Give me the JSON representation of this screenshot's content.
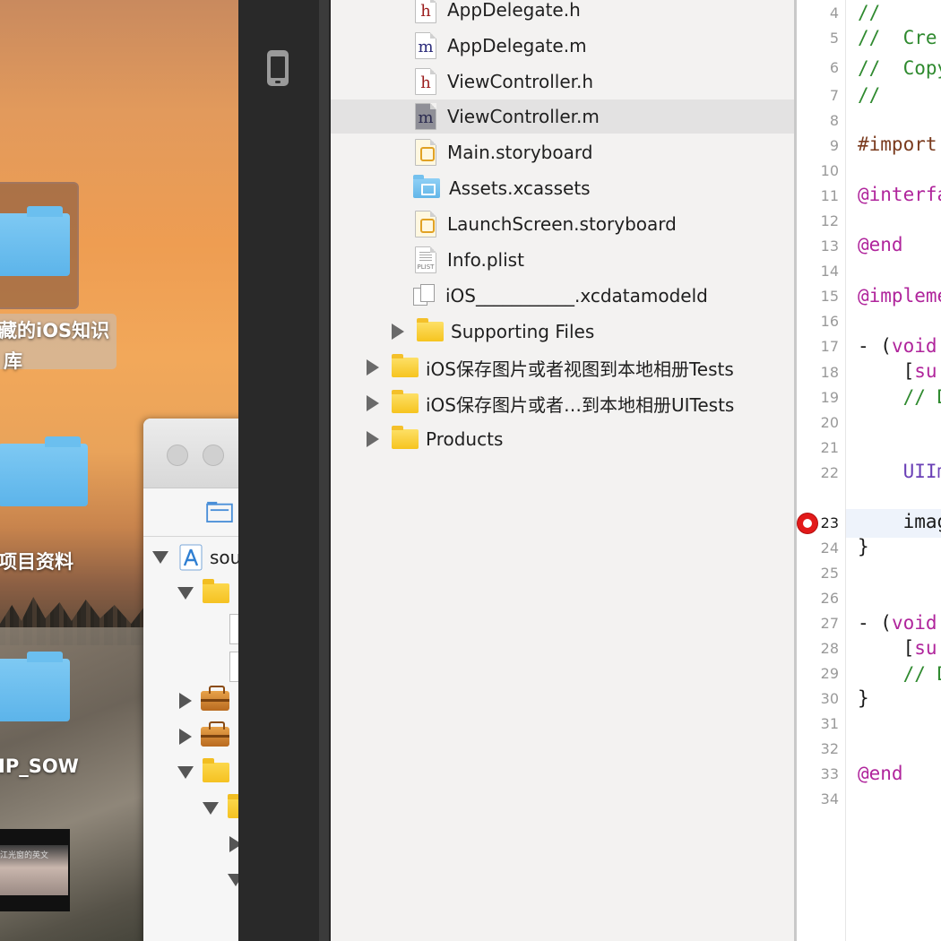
{
  "desktop": {
    "items": [
      {
        "label_line1": "藏的iOS知识",
        "label_line2": "库"
      },
      {
        "label": "项目资料"
      },
      {
        "label": "IP_SOW"
      }
    ],
    "thumbnail_text": "江光窗的英文"
  },
  "finder": {
    "tree": [
      {
        "label": "sou"
      }
    ]
  },
  "navigator": {
    "files": [
      {
        "label": "AppDelegate.h",
        "icon": "h-file-icon"
      },
      {
        "label": "AppDelegate.m",
        "icon": "m-file-icon"
      },
      {
        "label": "ViewController.h",
        "icon": "h-file-icon"
      },
      {
        "label": "ViewController.m",
        "icon": "m-file-icon",
        "selected": true
      },
      {
        "label": "Main.storyboard",
        "icon": "storyboard-icon"
      },
      {
        "label": "Assets.xcassets",
        "icon": "assets-folder-icon"
      },
      {
        "label": "LaunchScreen.storyboard",
        "icon": "storyboard-icon"
      },
      {
        "label": "Info.plist",
        "icon": "plist-icon"
      },
      {
        "label": "iOS___________.xcdatamodeld",
        "icon": "data-model-icon"
      },
      {
        "label": "Supporting Files",
        "icon": "folder-icon"
      },
      {
        "label": "iOS保存图片或者视图到本地相册Tests",
        "icon": "folder-icon"
      },
      {
        "label": "iOS保存图片或者…到本地相册UITests",
        "icon": "folder-icon"
      },
      {
        "label": "Products",
        "icon": "folder-icon"
      }
    ],
    "icon_letters": {
      "h": "h",
      "m": "m",
      "plist": "PLIST"
    }
  },
  "editor": {
    "line_numbers": [
      "4",
      "5",
      "6",
      "7",
      "8",
      "9",
      "10",
      "11",
      "12",
      "13",
      "14",
      "15",
      "16",
      "17",
      "18",
      "19",
      "20",
      "21",
      "22",
      "23",
      "24",
      "25",
      "26",
      "27",
      "28",
      "29",
      "30",
      "31",
      "32",
      "33",
      "34"
    ],
    "breakpoint_line": "23",
    "lines": {
      "l4": "//",
      "l5": "//  Cre",
      "l6": "//  Copy",
      "l7": "//",
      "l9": "#import",
      "l11": "@interfa",
      "l13": "@end",
      "l15": "@impleme",
      "l17a": "- (",
      "l17b": "void",
      "l18a": "    [",
      "l18b": "su",
      "l19": "    // D",
      "l22": "    UIIm",
      "l23": "    imag",
      "l24": "}",
      "l27a": "- (",
      "l27b": "void",
      "l28a": "    [",
      "l28b": "su",
      "l29": "    // D",
      "l30": "}",
      "l33": "@end"
    }
  },
  "colors": {
    "navigator_bg": "#f3f2f1",
    "selected_row": "#e3e2e2",
    "breakpoint": "#e21a1a",
    "comment": "#2f8a2f",
    "keyword": "#b0259c",
    "preprocessor": "#7a3b1e"
  }
}
